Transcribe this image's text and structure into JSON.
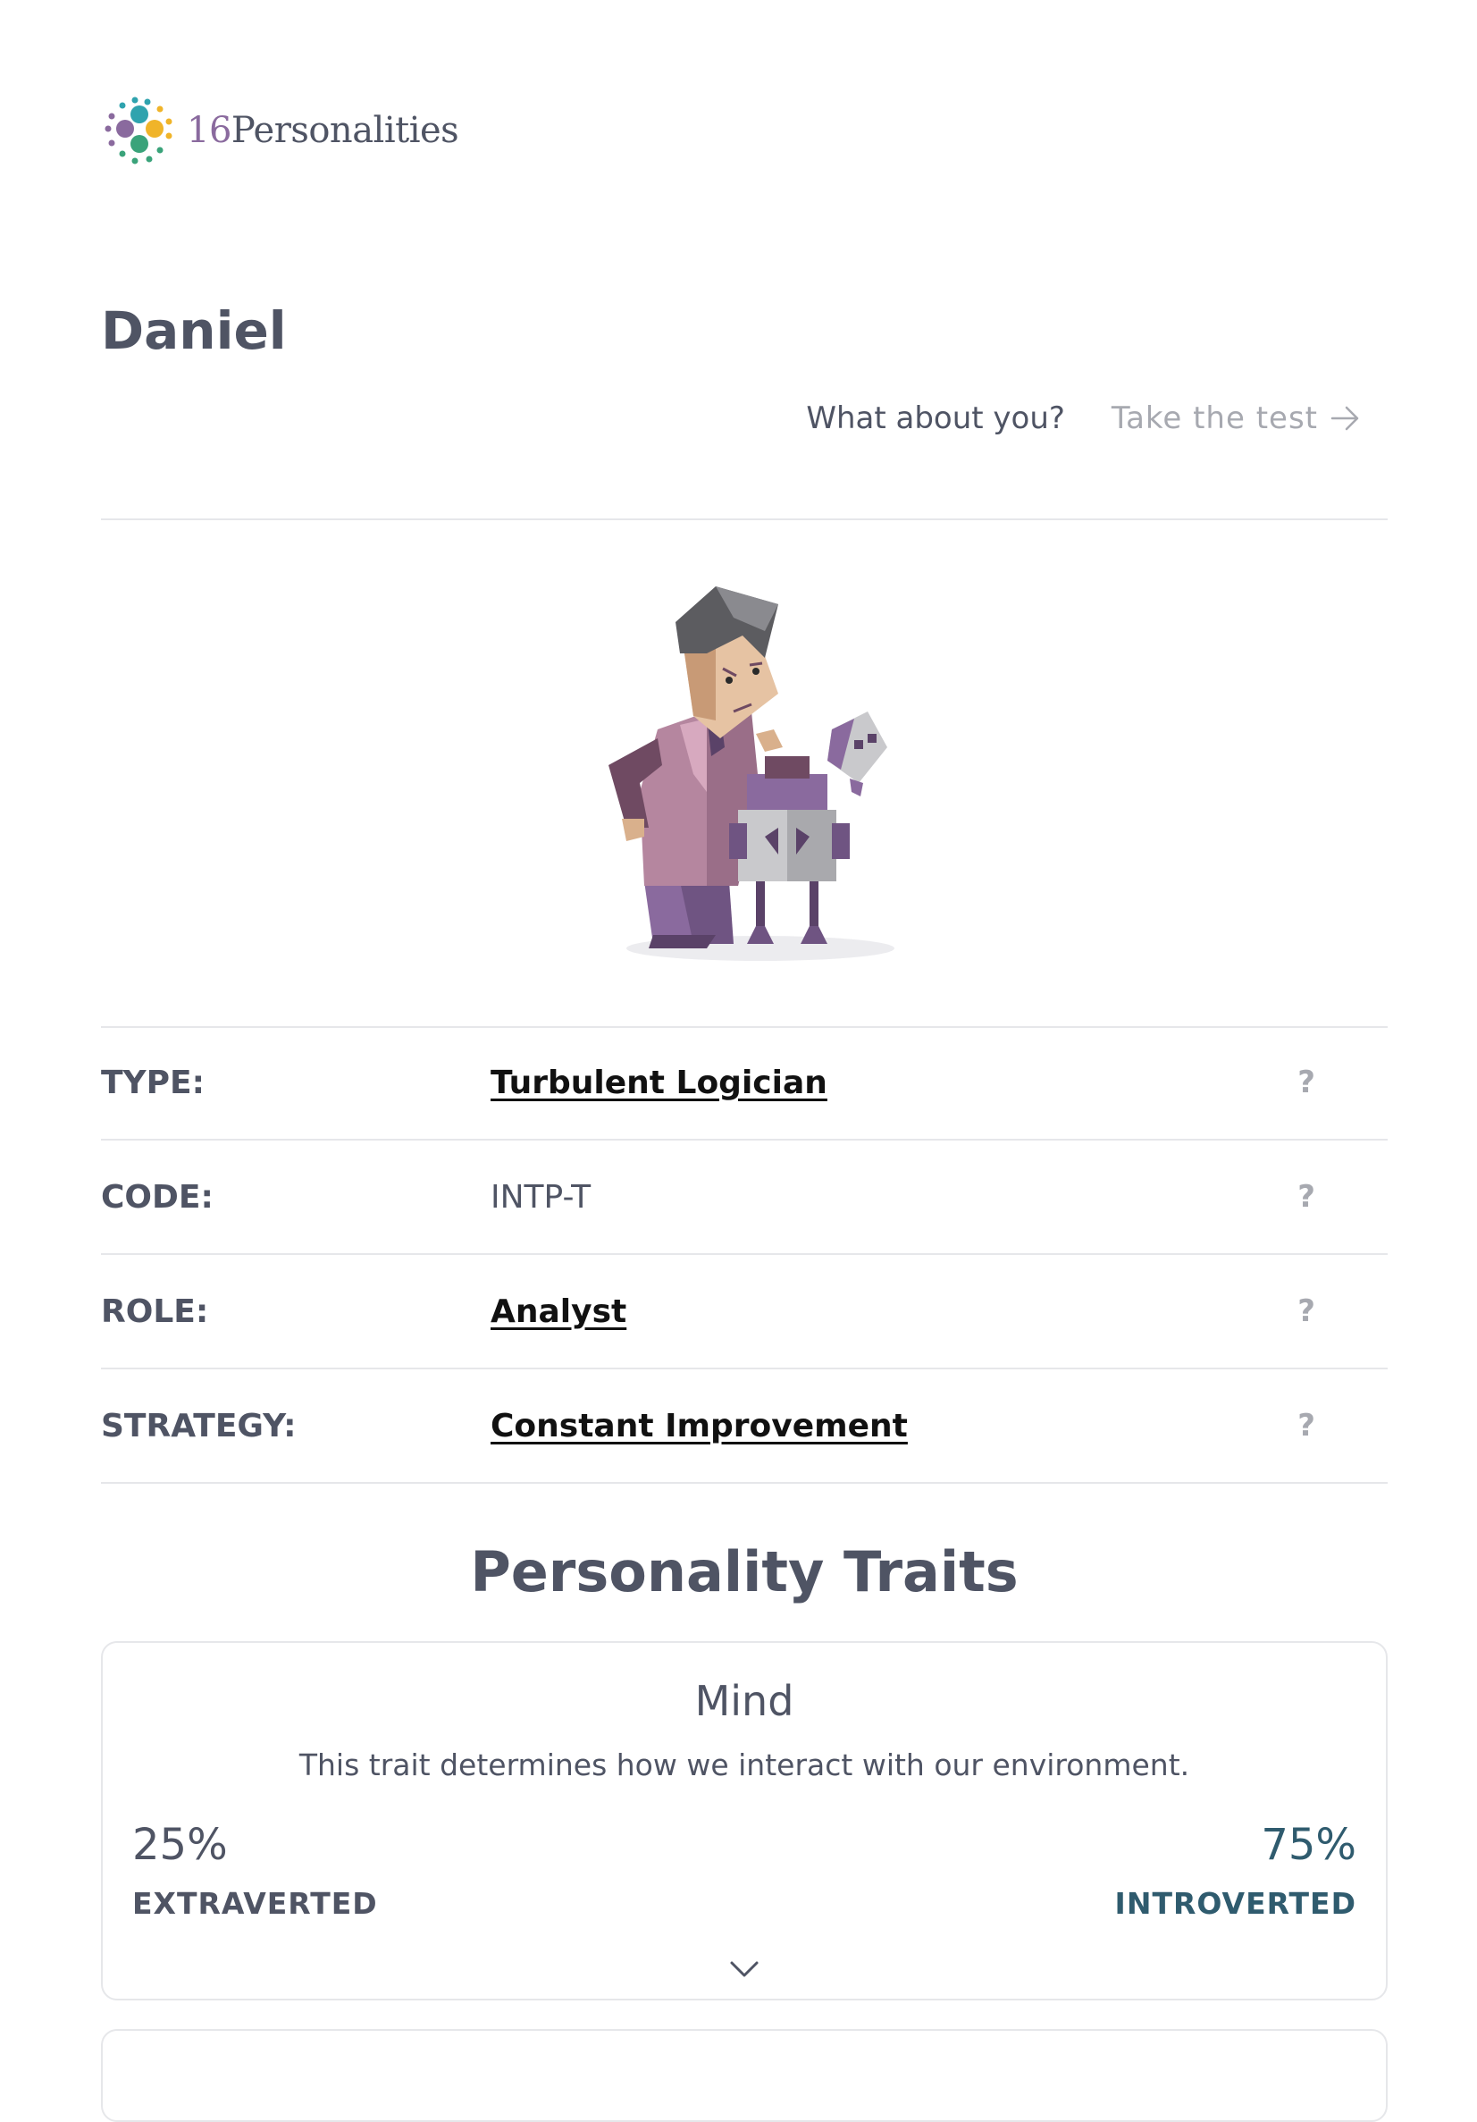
{
  "header": {
    "logo_number": "16",
    "logo_word": "Personalities"
  },
  "profile": {
    "name": "Daniel"
  },
  "cta": {
    "question": "What about you?",
    "link_label": "Take the test"
  },
  "info_rows": [
    {
      "label": "TYPE:",
      "value": "Turbulent Logician",
      "help": "?"
    },
    {
      "label": "CODE:",
      "value": "INTP-T",
      "help": "?"
    },
    {
      "label": "ROLE:",
      "value": "Analyst",
      "help": "?"
    },
    {
      "label": "STRATEGY:",
      "value": "Constant Improvement",
      "help": "?"
    }
  ],
  "traits_section": {
    "title": "Personality Traits",
    "mind": {
      "name": "Mind",
      "description": "This trait determines how we interact with our environment.",
      "left_percent": "25%",
      "left_label": "EXTRAVERTED",
      "right_percent": "75%",
      "right_label": "INTROVERTED"
    }
  },
  "colors": {
    "text": "#4f5464",
    "muted": "#a7a9b0",
    "divider": "#e6e7ea",
    "introverted_accent": "#2f5b6e",
    "logo_purple": "#8a6a9e"
  },
  "icons": {
    "arrow": "arrow-right-icon",
    "expand": "chevron-down-icon",
    "logo": "dots-cluster-logo-icon"
  }
}
